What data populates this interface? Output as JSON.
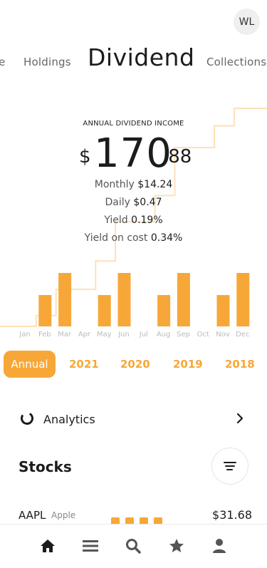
{
  "user": {
    "initials": "WL"
  },
  "nav_tabs": [
    {
      "label": "e"
    },
    {
      "label": "Holdings"
    },
    {
      "label": "Dividend"
    },
    {
      "label": "Collections"
    }
  ],
  "income": {
    "label": "ANNUAL DIVIDEND INCOME",
    "currency": "$",
    "integer": "170",
    "decimal": ".88",
    "stats": [
      {
        "name": "Monthly",
        "value": "$14.24"
      },
      {
        "name": "Daily",
        "value": "$0.47"
      },
      {
        "name": "Yield",
        "value": "0.19%"
      },
      {
        "name": "Yield on cost",
        "value": "0.34%"
      }
    ]
  },
  "chart_data": {
    "type": "bar",
    "categories": [
      "Jan",
      "Feb",
      "Mar",
      "Apr",
      "May",
      "Jun",
      "Jul",
      "Aug",
      "Sep",
      "Oct",
      "Nov",
      "Dec"
    ],
    "values": [
      0,
      44,
      75,
      0,
      44,
      75,
      0,
      44,
      75,
      0,
      44,
      75
    ],
    "cumulative_line": [
      0,
      5,
      17,
      17,
      30,
      48,
      48,
      60,
      82,
      82,
      92,
      100
    ],
    "colors": {
      "bar": "#f7a738",
      "line": "#fde2b8",
      "month_label": "#bbbbbb"
    }
  },
  "years": [
    {
      "label": "Annual"
    },
    {
      "label": "2021"
    },
    {
      "label": "2020"
    },
    {
      "label": "2019"
    },
    {
      "label": "2018"
    }
  ],
  "analytics": {
    "label": "Analytics"
  },
  "stocks": {
    "title": "Stocks",
    "rows": [
      {
        "symbol": "AAPL",
        "name": "Apple",
        "price": "$31.68"
      }
    ]
  },
  "bottom_nav": [
    {
      "icon": "home-icon"
    },
    {
      "icon": "list-icon"
    },
    {
      "icon": "search-icon"
    },
    {
      "icon": "star-icon"
    },
    {
      "icon": "user-icon"
    }
  ],
  "colors": {
    "accent": "#f7a738",
    "text": "#1c1c1c",
    "muted": "#666666"
  }
}
